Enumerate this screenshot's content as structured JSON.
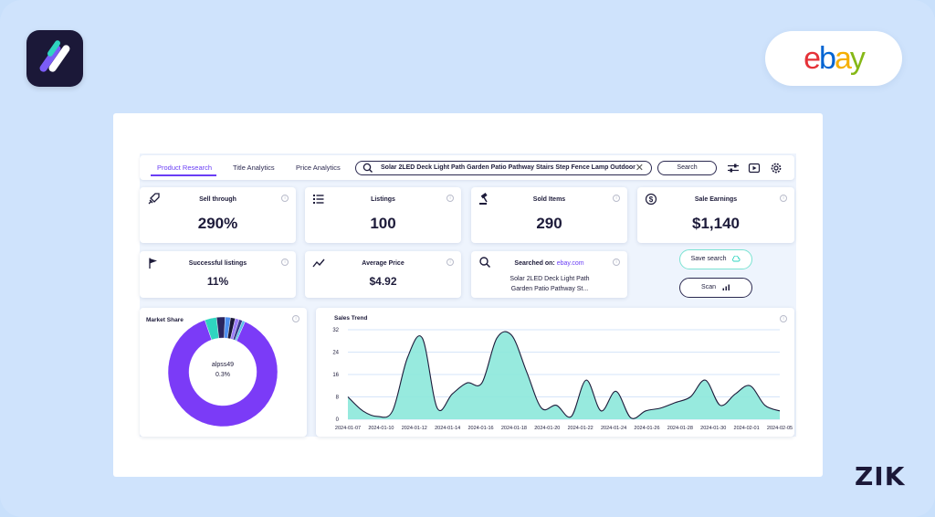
{
  "brand": {
    "ebay_letters": [
      {
        "ch": "e",
        "color": "#e53238"
      },
      {
        "ch": "b",
        "color": "#0064d2"
      },
      {
        "ch": "a",
        "color": "#f5af02"
      },
      {
        "ch": "y",
        "color": "#86b817"
      }
    ],
    "zik": "ZIK"
  },
  "colors": {
    "accent": "#6a3ef5",
    "teal": "#2fd5c0",
    "area_fill": "#8ce8da",
    "dark": "#1d1b3a"
  },
  "tabs": [
    {
      "label": "Product Research",
      "active": true
    },
    {
      "label": "Title Analytics",
      "active": false
    },
    {
      "label": "Price Analytics",
      "active": false
    }
  ],
  "search": {
    "query": "Solar 2LED Deck Light Path Garden Patio Pathway Stairs Step Fence Lamp Outdoor",
    "button": "Search"
  },
  "toolbar_icons": [
    "sliders-icon",
    "video-icon",
    "gear-icon"
  ],
  "stats": {
    "sell_through": {
      "label": "Sell through",
      "value": "290%",
      "icon": "rocket-icon"
    },
    "listings": {
      "label": "Listings",
      "value": "100",
      "icon": "list-icon"
    },
    "sold_items": {
      "label": "Sold Items",
      "value": "290",
      "icon": "gavel-icon"
    },
    "sale_earnings": {
      "label": "Sale Earnings",
      "value": "$1,140",
      "icon": "dollar-icon"
    },
    "successful_listings": {
      "label": "Successful listings",
      "value": "11%",
      "icon": "flag-icon"
    },
    "average_price": {
      "label": "Average Price",
      "value": "$4.92",
      "icon": "trend-icon"
    }
  },
  "searched_on": {
    "prefix": "Searched on:",
    "site": "ebay.com",
    "product": "Solar 2LED Deck Light Path Garden Patio Pathway St..."
  },
  "actions": {
    "save_search": "Save search",
    "scan": "Scan"
  },
  "market_share": {
    "title": "Market Share",
    "center_seller": "alpss49",
    "center_share": "0.3%",
    "slices": [
      {
        "color": "#7b3bf7",
        "value": 88.0
      },
      {
        "color": "#2fd5c0",
        "value": 3.5
      },
      {
        "color": "#2a2560",
        "value": 2.5
      },
      {
        "color": "#4e8ff0",
        "value": 1.6
      },
      {
        "color": "#1b1838",
        "value": 1.4
      },
      {
        "color": "#9a7cf8",
        "value": 1.2
      },
      {
        "color": "#3b3a8e",
        "value": 1.0
      },
      {
        "color": "#5bc0eb",
        "value": 0.8
      }
    ]
  },
  "chart_data": {
    "type": "area",
    "title": "Sales Trend",
    "x_tick_labels": [
      "2024-01-07",
      "2024-01-10",
      "2024-01-12",
      "2024-01-14",
      "2024-01-16",
      "2024-01-18",
      "2024-01-20",
      "2024-01-22",
      "2024-01-24",
      "2024-01-26",
      "2024-01-28",
      "2024-01-30",
      "2024-02-01",
      "2024-02-05"
    ],
    "y_ticks": [
      0,
      8,
      16,
      24,
      32
    ],
    "ylim": [
      0,
      32
    ],
    "grid": true,
    "series": [
      {
        "values": [
          8,
          3,
          1,
          3,
          22,
          29,
          4,
          9,
          13,
          13,
          29,
          30,
          17,
          4,
          5,
          1,
          14,
          3,
          10,
          0.5,
          3,
          4,
          6,
          8,
          14,
          5,
          9,
          12,
          5,
          3
        ]
      }
    ]
  }
}
